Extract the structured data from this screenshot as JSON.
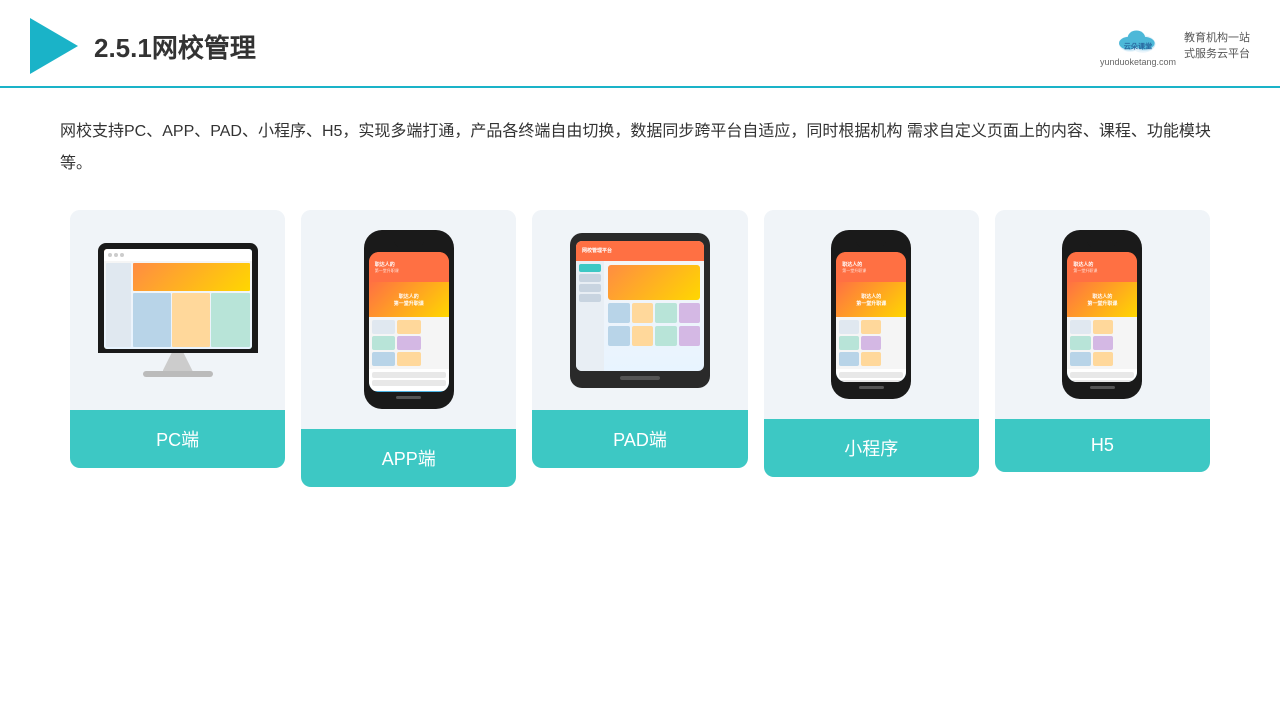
{
  "header": {
    "title": "2.5.1网校管理",
    "brand": {
      "name": "云朵课堂",
      "url": "yunduoketang.com",
      "tagline": "教育机构一站\n式服务云平台"
    }
  },
  "description": "网校支持PC、APP、PAD、小程序、H5，实现多端打通，产品各终端自由切换，数据同步跨平台自适应，同时根据机构\n需求自定义页面上的内容、课程、功能模块等。",
  "cards": [
    {
      "id": "pc",
      "label": "PC端",
      "type": "monitor"
    },
    {
      "id": "app",
      "label": "APP端",
      "type": "phone"
    },
    {
      "id": "pad",
      "label": "PAD端",
      "type": "tablet"
    },
    {
      "id": "miniprogram",
      "label": "小程序",
      "type": "phone-sm"
    },
    {
      "id": "h5",
      "label": "H5",
      "type": "phone-sm"
    }
  ],
  "colors": {
    "accent": "#3dc8c4",
    "dark": "#1ab3c8",
    "text": "#333333"
  }
}
